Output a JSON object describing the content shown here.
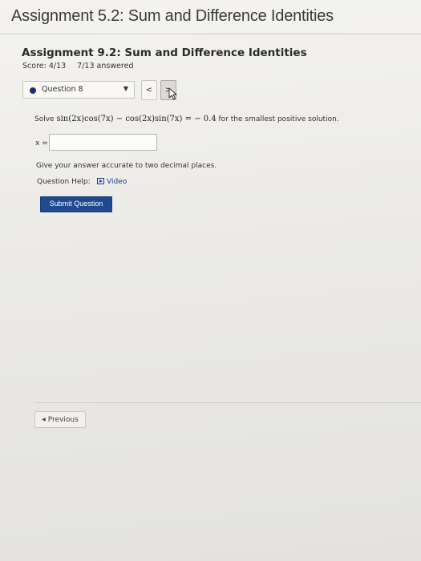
{
  "page": {
    "title": "Assignment 5.2: Sum and Difference Identities"
  },
  "assignment": {
    "heading": "Assignment 9.2: Sum and Difference Identities",
    "score": "Score: 4/13",
    "answered": "7/13 answered"
  },
  "question_nav": {
    "selected": "Question 8",
    "prev_label": "<",
    "next_label": ">"
  },
  "question": {
    "prefix": "Solve ",
    "expression": "sin(2x)cos(7x) − cos(2x)sin(7x) = − 0.4",
    "suffix": " for the smallest positive solution."
  },
  "answer": {
    "label": "x =",
    "value": "",
    "placeholder": ""
  },
  "instructions": "Give your answer accurate to two decimal places.",
  "help": {
    "label": "Question Help:",
    "video_label": "Video"
  },
  "submit_label": "Submit Question",
  "previous_label": "Previous",
  "colors": {
    "accent": "#1f4a8f",
    "link": "#1b3b8a",
    "status_dot": "#1a2f6e"
  }
}
